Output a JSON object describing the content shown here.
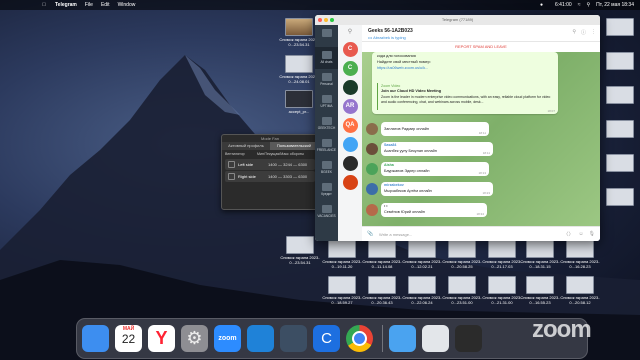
{
  "menubar": {
    "app": "Telegram",
    "menus": [
      "File",
      "Edit",
      "Window"
    ],
    "clock": "6:41:00",
    "date": "Пт, 22 мая 18:34"
  },
  "desktop_icons": [
    {
      "label": "Снимок экрана 2023-0...23.54.31"
    },
    {
      "label": "Снимок экрана 2023-0...24.08.01"
    },
    {
      "label": "Снимок экрана 2023-0...23.02.35"
    },
    {
      "label": "accept_pr..."
    },
    {
      "label": "accept_pr..."
    },
    {
      "label": "Снимок экрана 2023-0...19.11.20"
    },
    {
      "label": "Снимок экрана 2023-0...11.14.08"
    },
    {
      "label": "Снимок экрана 2023-0...12.02.21"
    },
    {
      "label": "Снимок экрана 2023-0...20.58.25"
    },
    {
      "label": "Снимок экрана 2023-0...21.17.03"
    },
    {
      "label": "Снимок экрана 2023-0...18.31.15"
    },
    {
      "label": "Снимок экрана 2023-0...16.28.23"
    },
    {
      "label": "Снимок экрана 2023-0...18.59.27"
    },
    {
      "label": "Снимок экрана 2023-0...20.36.43"
    },
    {
      "label": "Снимок экрана 2023-0...22.06.24"
    },
    {
      "label": "Снимок экрана 2023-0...23.51.00"
    },
    {
      "label": "Снимок экрана 2023-0...21.31.00"
    },
    {
      "label": "Снимок экрана 2023-0...16.55.23"
    },
    {
      "label": "Снимок экрана 2023-0...20.58.12"
    },
    {
      "label": "Снимок экрана 2023-0...21.31.00"
    }
  ],
  "profiles_window": {
    "title": "Mode Fan",
    "tabs": [
      "Активный профиль",
      "Пользовательский"
    ],
    "columns": [
      "Вентилятор",
      "Мин/Текущая/Макс обороты"
    ],
    "rows": [
      {
        "label": "Left side",
        "value": "1400 — 3244 — 6300"
      },
      {
        "label": "Right side",
        "value": "1400 — 3303 — 6300"
      }
    ]
  },
  "telegram": {
    "window_title": "Telegram (77189)",
    "folders": [
      {
        "label": "All chats"
      },
      {
        "label": "Personal"
      },
      {
        "label": "UPTIMA"
      },
      {
        "label": "GEEKTECH"
      },
      {
        "label": "FREELANCE"
      },
      {
        "label": "BGEEK"
      },
      {
        "label": "Кредит"
      },
      {
        "label": "VACANCIES"
      }
    ],
    "chat_avatars": [
      {
        "letter": "C",
        "color": "#e85a4f"
      },
      {
        "letter": "C",
        "color": "#4caf50"
      },
      {
        "letter": "",
        "color": "#1a3b2a"
      },
      {
        "letter": "AR",
        "color": "#9575cd"
      },
      {
        "letter": "QA",
        "color": "#ff7043"
      },
      {
        "letter": "",
        "color": "#42a5f5"
      },
      {
        "letter": "",
        "color": "#2a2a2a"
      },
      {
        "letter": "",
        "color": "#d84315"
      }
    ],
    "chat_name": "Geeks 56-1A2B023",
    "chat_status": "Abrazbek is typing",
    "spam_banner": "REPORT SPAM AND LEAVE",
    "big_message": {
      "lines": [
        "кода для голосования",
        "Найдите свой местный номер:",
        "https://us06web.zoom.us/u/k..."
      ],
      "preview_source": "Zoom Video",
      "preview_title": "Join our Cloud HD Video Meeting",
      "preview_text": "Zoom is the leader in modern enterprise video communications, with an easy, reliable cloud platform for video and audio conferencing, chat, and webinars across mobile, desk...",
      "time": "18:07"
    },
    "messages": [
      {
        "sender": "",
        "text": "Заплатов Радмир онлайн",
        "time": "18:11",
        "avatar": "#8a6d4b"
      },
      {
        "sender": "Sasa84",
        "text": "Асанбек уулу Бекулан онлайн",
        "time": "18:11",
        "avatar": "#6b4f3a",
        "sender_color": "#4b8fd1"
      },
      {
        "sender": "Aisha",
        "text": "Бауржанов Эдиер онлайн",
        "time": "18:13",
        "avatar": "#4ca35a",
        "sender_color": "#3aa55b"
      },
      {
        "sender": "mirzabekov",
        "text": "Мырзабеков Артём онлайн",
        "time": "18:23",
        "avatar": "#3c6ea8",
        "sender_color": "#4b8fd1"
      },
      {
        "sender": "Семёнов",
        "text": "Семёнов Юрий онлайн",
        "time": "18:34",
        "avatar": "#b56a4a",
        "sender_color": "#c0392b"
      }
    ],
    "compose_placeholder": "Write a message..."
  },
  "dock_apps": [
    {
      "name": "Finder",
      "color": "#3d8ef0"
    },
    {
      "name": "Calendar",
      "month": "МАЙ",
      "day": "22",
      "color": "#ffffff"
    },
    {
      "name": "Yandex Browser",
      "color": "#ffffff"
    },
    {
      "name": "System Preferences",
      "color": "#8e8e93"
    },
    {
      "name": "Zoom",
      "color": "#2d8cff"
    },
    {
      "name": "Xcode",
      "color": "#1f82d8"
    },
    {
      "name": "Android Studio",
      "color": "#3c4e63"
    },
    {
      "name": "Codeshot",
      "color": "#1d6fe0"
    },
    {
      "name": "Chrome",
      "color": "#ffffff"
    },
    {
      "name": "Downloads",
      "color": "#4aa3f0"
    },
    {
      "name": "Preview",
      "color": "#e3e6ea"
    },
    {
      "name": "Recent",
      "color": "#2b2b2b"
    }
  ],
  "zoom_watermark": "zoom"
}
